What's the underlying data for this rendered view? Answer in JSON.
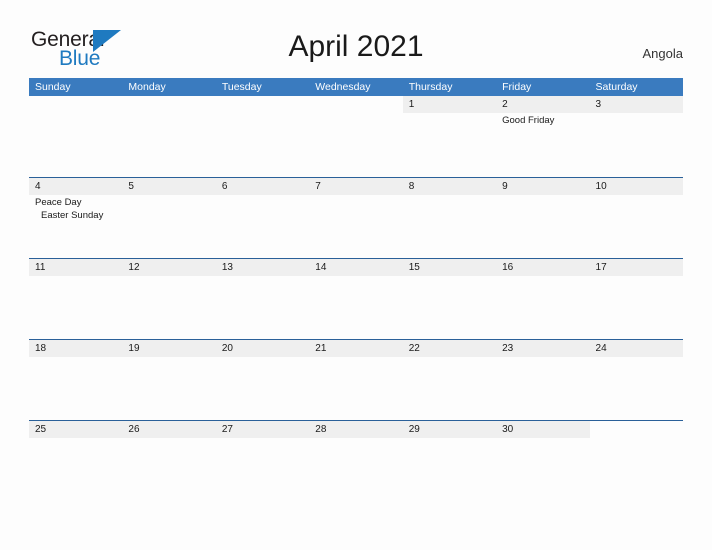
{
  "brand": {
    "name_part1": "General",
    "name_part2": "Blue",
    "triangle_icon": "brand-triangle-icon",
    "accent_color": "#1f7ac0"
  },
  "header": {
    "title": "April 2021",
    "country": "Angola"
  },
  "colors": {
    "weekday_header_bg": "#3a7bbf",
    "weekday_header_text": "#ffffff",
    "date_band_bg": "#efefef",
    "row_border": "#2a6099",
    "page_bg": "#fdfdfd"
  },
  "calendar": {
    "weekdays": [
      "Sunday",
      "Monday",
      "Tuesday",
      "Wednesday",
      "Thursday",
      "Friday",
      "Saturday"
    ],
    "weeks": [
      [
        {
          "date": "",
          "events": []
        },
        {
          "date": "",
          "events": []
        },
        {
          "date": "",
          "events": []
        },
        {
          "date": "",
          "events": []
        },
        {
          "date": "1",
          "events": []
        },
        {
          "date": "2",
          "events": [
            "Good Friday"
          ]
        },
        {
          "date": "3",
          "events": []
        }
      ],
      [
        {
          "date": "4",
          "events": [
            "Peace Day",
            "Easter Sunday"
          ]
        },
        {
          "date": "5",
          "events": []
        },
        {
          "date": "6",
          "events": []
        },
        {
          "date": "7",
          "events": []
        },
        {
          "date": "8",
          "events": []
        },
        {
          "date": "9",
          "events": []
        },
        {
          "date": "10",
          "events": []
        }
      ],
      [
        {
          "date": "11",
          "events": []
        },
        {
          "date": "12",
          "events": []
        },
        {
          "date": "13",
          "events": []
        },
        {
          "date": "14",
          "events": []
        },
        {
          "date": "15",
          "events": []
        },
        {
          "date": "16",
          "events": []
        },
        {
          "date": "17",
          "events": []
        }
      ],
      [
        {
          "date": "18",
          "events": []
        },
        {
          "date": "19",
          "events": []
        },
        {
          "date": "20",
          "events": []
        },
        {
          "date": "21",
          "events": []
        },
        {
          "date": "22",
          "events": []
        },
        {
          "date": "23",
          "events": []
        },
        {
          "date": "24",
          "events": []
        }
      ],
      [
        {
          "date": "25",
          "events": []
        },
        {
          "date": "26",
          "events": []
        },
        {
          "date": "27",
          "events": []
        },
        {
          "date": "28",
          "events": []
        },
        {
          "date": "29",
          "events": []
        },
        {
          "date": "30",
          "events": []
        },
        {
          "date": "",
          "events": []
        }
      ]
    ]
  }
}
